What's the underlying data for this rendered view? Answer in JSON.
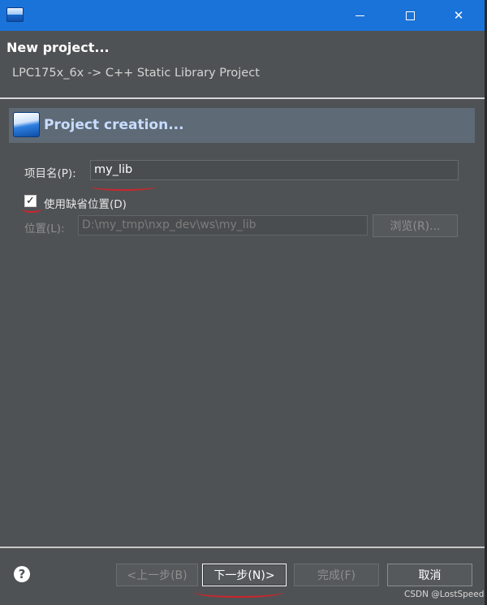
{
  "window": {
    "header_title": "New project...",
    "header_subtitle": "LPC175x_6x -> C++ Static Library Project"
  },
  "page": {
    "title": "Project creation..."
  },
  "form": {
    "project_name_label": "项目名(P):",
    "project_name_value": "my_lib",
    "use_default_location_label": "使用缺省位置(D)",
    "use_default_location_checked": true,
    "location_label": "位置(L):",
    "location_value": "D:\\my_tmp\\nxp_dev\\ws\\my_lib",
    "browse_label": "浏览(R)..."
  },
  "footer": {
    "help_label": "?",
    "back_label": "<上一步(B)",
    "next_label": "下一步(N)>",
    "finish_label": "完成(F)",
    "cancel_label": "取消"
  },
  "watermark": "CSDN @LostSpeed",
  "icons": [
    "app-icon",
    "minimize-icon",
    "maximize-icon",
    "close-icon",
    "banner-icon",
    "check-icon",
    "help-icon"
  ],
  "colors": {
    "titlebar": "#1a73d9",
    "background": "#4f5254",
    "banner": "#5e6a76",
    "annotation": "#d0242b"
  }
}
